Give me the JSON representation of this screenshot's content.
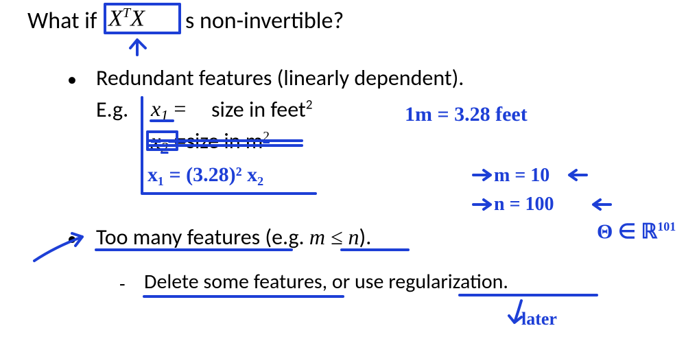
{
  "heading": {
    "prefix": "What if",
    "formula": "X",
    "formula_sup": "T",
    "formula2": "X",
    "suffix": "s non-invertible?"
  },
  "bullet1": {
    "text": "Redundant features (linearly dependent).",
    "eg_label": "E.g.",
    "x1_var": "x",
    "x1_sub": "1",
    "x1_eq": " =",
    "x1_desc": "size in feet",
    "x1_unit_sup": "2",
    "x2_var": "x",
    "x2_sub": "2",
    "x2_eq": " =",
    "x2_desc": "size in m",
    "x2_unit_sup": "2"
  },
  "ink": {
    "conv": "1m  =  3.28  feet",
    "eq_x1": "x₁  =  (3.28)² x₂",
    "m_eq": "m = 10",
    "n_eq": "n = 100",
    "theta": "Θ ∈ ℝ",
    "theta_sup": "101",
    "later_arrow_label": "later"
  },
  "bullet2": {
    "text_a": "Too many features",
    "text_b": " (e.g. ",
    "mn": "m ≤ n",
    "text_c": ")."
  },
  "sub_bullet": {
    "text_a": "Delete some features, or use ",
    "text_b": "regularization",
    "text_c": "."
  }
}
